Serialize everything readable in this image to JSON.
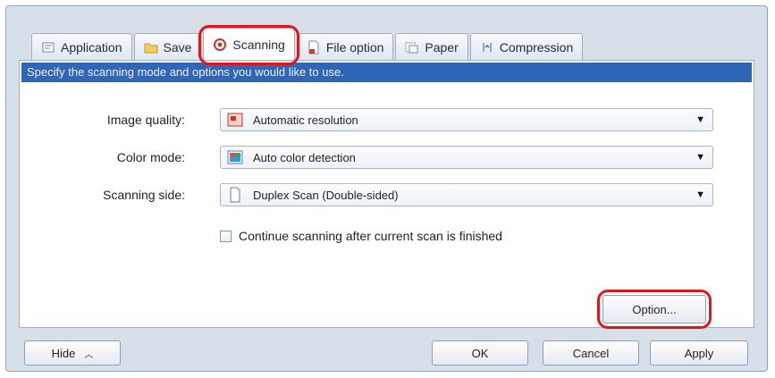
{
  "tabs": [
    {
      "label": "Application",
      "icon": "application-icon",
      "active": false
    },
    {
      "label": "Save",
      "icon": "folder-icon",
      "active": false
    },
    {
      "label": "Scanning",
      "icon": "scanning-icon",
      "active": true
    },
    {
      "label": "File option",
      "icon": "file-option-icon",
      "active": false
    },
    {
      "label": "Paper",
      "icon": "paper-icon",
      "active": false
    },
    {
      "label": "Compression",
      "icon": "compression-icon",
      "active": false
    }
  ],
  "panel": {
    "description": "Specify the scanning mode and options you would like to use.",
    "image_quality": {
      "label": "Image quality:",
      "value": "Automatic resolution"
    },
    "color_mode": {
      "label": "Color mode:",
      "value": "Auto color detection"
    },
    "scanning_side": {
      "label": "Scanning side:",
      "value": "Duplex Scan (Double-sided)"
    },
    "continue_checkbox": {
      "label": "Continue scanning after current scan is finished",
      "checked": false
    },
    "option_button": "Option..."
  },
  "footer": {
    "hide_button": "Hide",
    "ok_button": "OK",
    "cancel_button": "Cancel",
    "apply_button": "Apply"
  },
  "colors": {
    "highlight": "#e0161b",
    "description_bar": "#2f66b5"
  }
}
